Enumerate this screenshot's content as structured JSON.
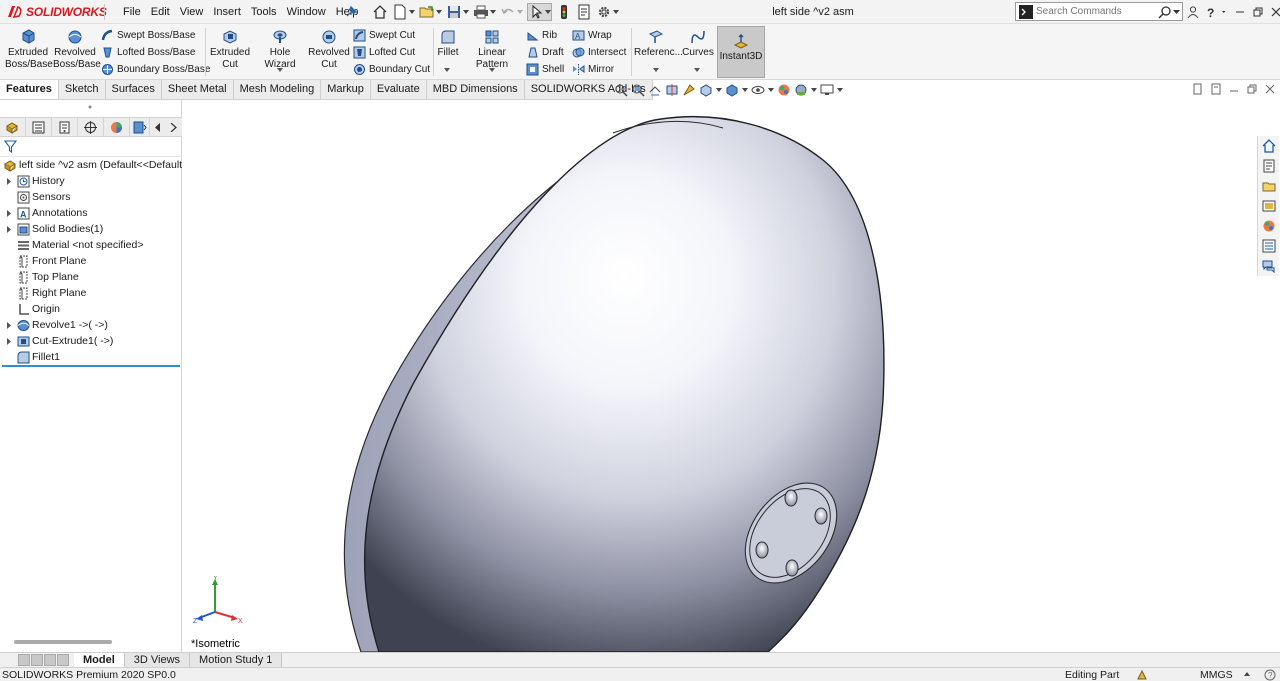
{
  "app": {
    "brand": "SOLIDWORKS",
    "window_title": "left side ^v2 asm"
  },
  "menu": [
    "File",
    "Edit",
    "View",
    "Insert",
    "Tools",
    "Window",
    "Help"
  ],
  "search": {
    "placeholder": "Search Commands"
  },
  "commands": {
    "extruded_boss": [
      "Extruded",
      "Boss/Base"
    ],
    "revolved_boss": [
      "Revolved",
      "Boss/Base"
    ],
    "swept_boss": "Swept Boss/Base",
    "lofted_boss": "Lofted Boss/Base",
    "boundary_boss": "Boundary Boss/Base",
    "extruded_cut": [
      "Extruded",
      "Cut"
    ],
    "hole_wizard": "Hole Wizard",
    "revolved_cut": [
      "Revolved",
      "Cut"
    ],
    "swept_cut": "Swept Cut",
    "lofted_cut": "Lofted Cut",
    "boundary_cut": "Boundary Cut",
    "fillet": "Fillet",
    "linear_pattern": "Linear Pattern",
    "rib": "Rib",
    "draft": "Draft",
    "shell": "Shell",
    "wrap": "Wrap",
    "intersect": "Intersect",
    "mirror": "Mirror",
    "reference": "Referenc...",
    "curves": "Curves",
    "instant3d": "Instant3D"
  },
  "cm_tabs": [
    {
      "label": "Features",
      "active": true
    },
    {
      "label": "Sketch",
      "active": false
    },
    {
      "label": "Surfaces",
      "active": false
    },
    {
      "label": "Sheet Metal",
      "active": false
    },
    {
      "label": "Mesh Modeling",
      "active": false
    },
    {
      "label": "Markup",
      "active": false
    },
    {
      "label": "Evaluate",
      "active": false
    },
    {
      "label": "MBD Dimensions",
      "active": false
    },
    {
      "label": "SOLIDWORKS Add-Ins",
      "active": false
    }
  ],
  "tree": [
    {
      "label": "left side ^v2 asm  (Default<<Default",
      "icon": "part-icon",
      "expand": false,
      "root": true
    },
    {
      "label": "History",
      "icon": "history-icon",
      "expand": true
    },
    {
      "label": "Sensors",
      "icon": "sensors-icon",
      "expand": false
    },
    {
      "label": "Annotations",
      "icon": "annotations-icon",
      "expand": true
    },
    {
      "label": "Solid Bodies(1)",
      "icon": "solid-bodies-icon",
      "expand": true
    },
    {
      "label": "Material <not specified>",
      "icon": "material-icon",
      "expand": false
    },
    {
      "label": "Front Plane",
      "icon": "plane-icon",
      "expand": false
    },
    {
      "label": "Top Plane",
      "icon": "plane-icon",
      "expand": false
    },
    {
      "label": "Right Plane",
      "icon": "plane-icon",
      "expand": false
    },
    {
      "label": "Origin",
      "icon": "origin-icon",
      "expand": false
    },
    {
      "label": "Revolve1 ->( ->)",
      "icon": "revolve-icon",
      "expand": true
    },
    {
      "label": "Cut-Extrude1( ->)",
      "icon": "cut-extrude-icon",
      "expand": true
    },
    {
      "label": "Fillet1",
      "icon": "fillet-icon",
      "expand": false
    }
  ],
  "viewport": {
    "view_label": "*Isometric",
    "triad": {
      "x": "X",
      "y": "Y",
      "z": "Z"
    }
  },
  "bottom_tabs": [
    {
      "label": "Model",
      "active": true
    },
    {
      "label": "3D Views",
      "active": false
    },
    {
      "label": "Motion Study 1",
      "active": false
    }
  ],
  "status": {
    "product": "SOLIDWORKS Premium 2020 SP0.0",
    "mode": "Editing Part",
    "units": "MMGS"
  },
  "colors": {
    "brand_red": "#d71920",
    "rollback_blue": "#2a8fd6",
    "model_highlight": "#ffffff",
    "model_shadow": "#3f4250"
  }
}
